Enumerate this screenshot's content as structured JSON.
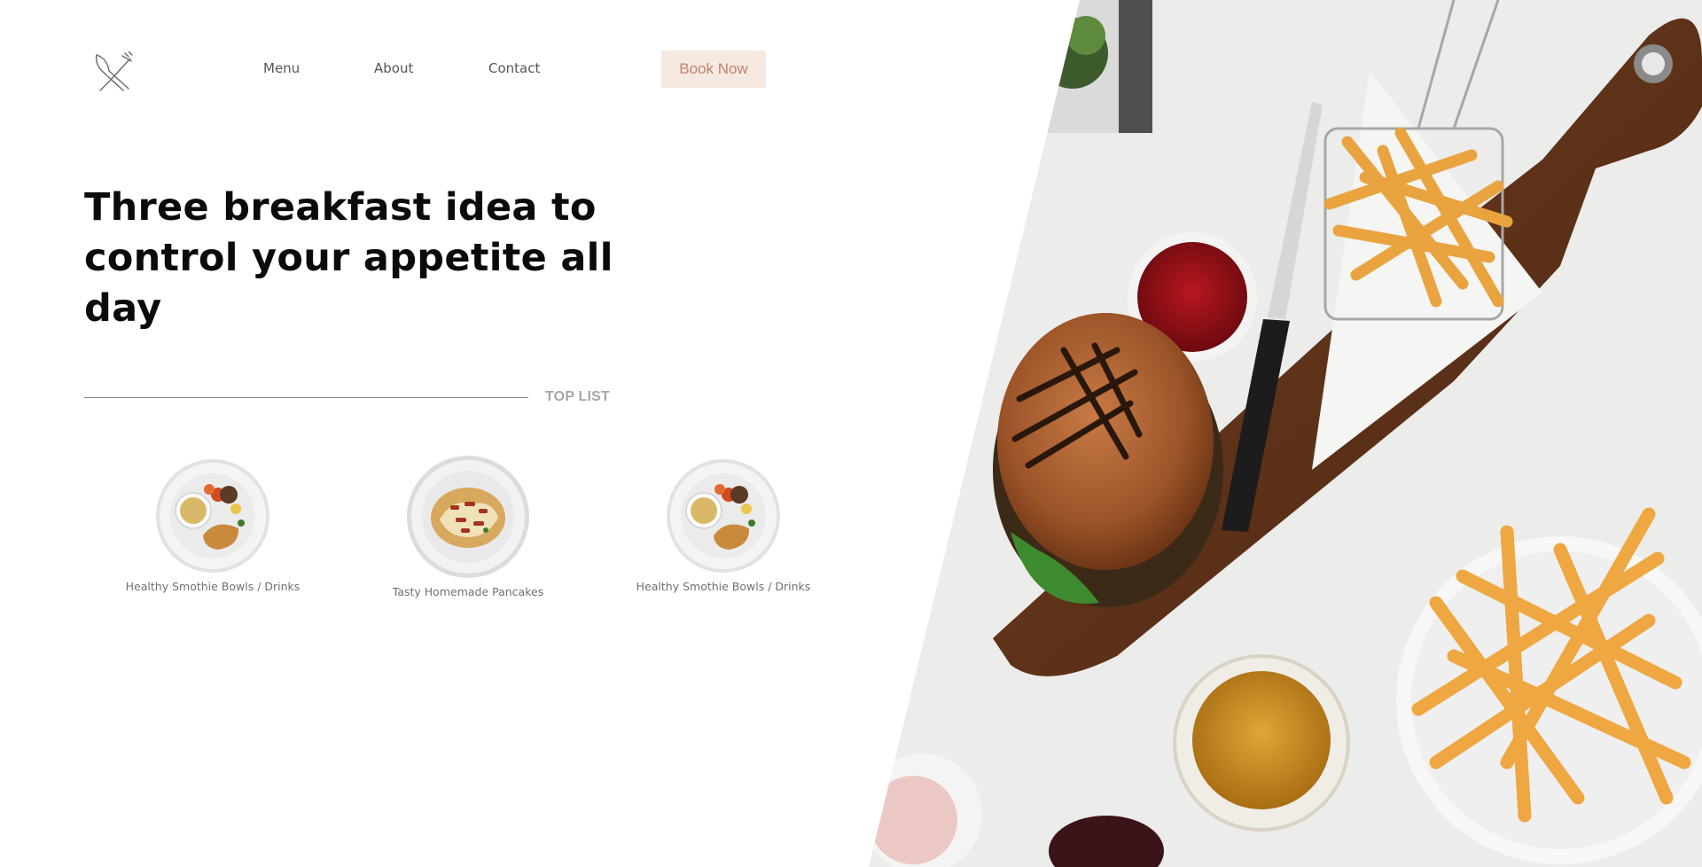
{
  "header": {
    "logo_icon": "fork-knife-icon",
    "nav": [
      {
        "label": "Menu"
      },
      {
        "label": "About"
      },
      {
        "label": "Contact"
      }
    ],
    "book_label": "Book Now"
  },
  "hero": {
    "headline_line1": "Three breakfast idea to",
    "headline_line2": "control your appetite all day",
    "image_icon": "burger-fries-photo"
  },
  "top_list": {
    "label": "TOP LIST",
    "items": [
      {
        "caption": "Healthy Smothie Bowls / Drinks",
        "image": "plate-shrimp-photo"
      },
      {
        "caption": "Tasty Homemade Pancakes",
        "image": "plate-pancakes-photo"
      },
      {
        "caption": "Healthy Smothie Bowls / Drinks",
        "image": "plate-shrimp-photo"
      }
    ]
  },
  "colors": {
    "accent_bg": "#f6e9e1",
    "accent_text": "#c0826a",
    "board": "#6a3c22",
    "table": "#eeeeec"
  }
}
